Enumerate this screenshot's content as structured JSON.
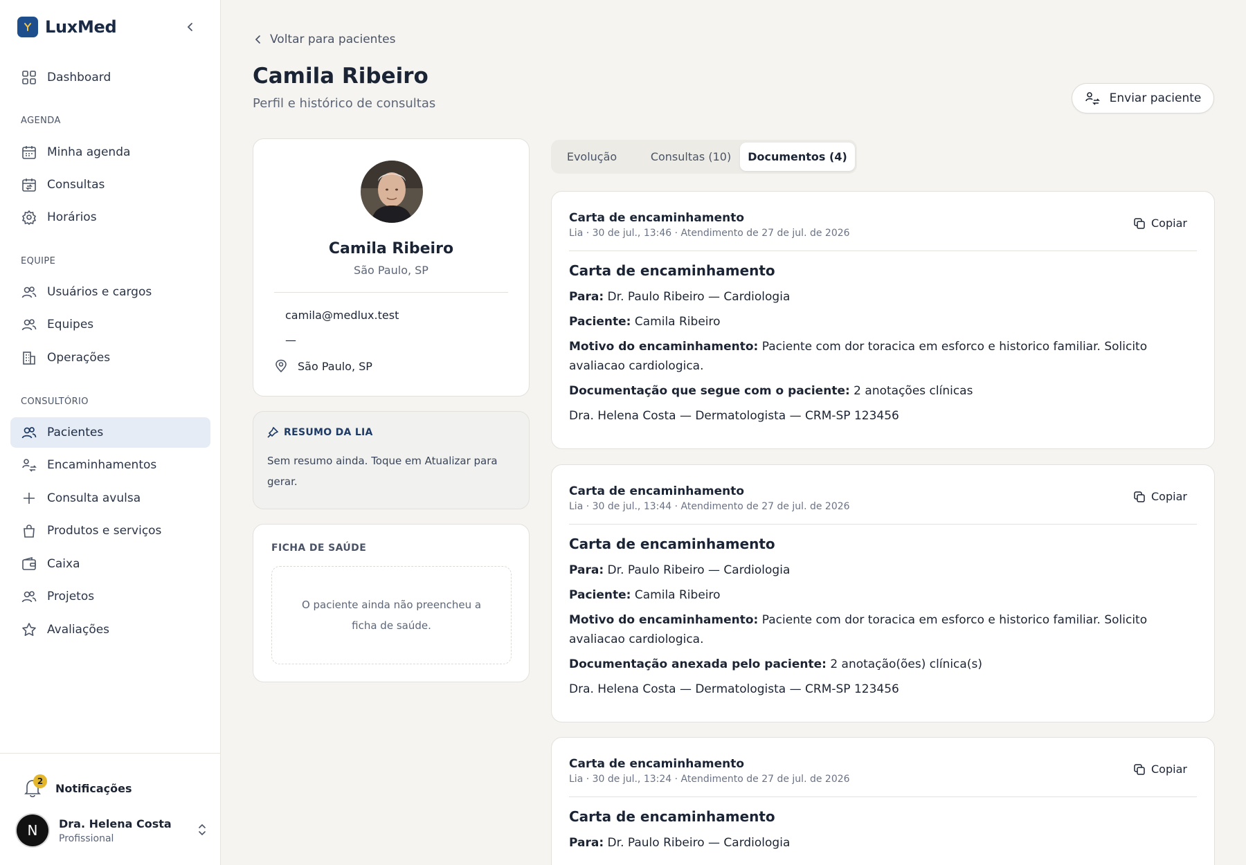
{
  "brand": {
    "name": "LuxMed"
  },
  "sidebar": {
    "dashboard": "Dashboard",
    "sections": {
      "agenda": "AGENDA",
      "equipe": "EQUIPE",
      "consultorio": "CONSULTÓRIO"
    },
    "agenda_items": [
      "Minha agenda",
      "Consultas",
      "Horários"
    ],
    "equipe_items": [
      "Usuários e cargos",
      "Equipes",
      "Operações"
    ],
    "consultorio_items": [
      "Pacientes",
      "Encaminhamentos",
      "Consulta avulsa",
      "Produtos e serviços",
      "Caixa",
      "Projetos",
      "Avaliações"
    ],
    "notifications_label": "Notificações",
    "notifications_count": "2",
    "user": {
      "initial": "N",
      "name": "Dra. Helena Costa",
      "role": "Profissional"
    }
  },
  "header": {
    "back_label": "Voltar para pacientes",
    "title": "Camila Ribeiro",
    "subtitle": "Perfil e histórico de consultas",
    "send_label": "Enviar paciente"
  },
  "profile": {
    "name": "Camila Ribeiro",
    "location": "São Paulo, SP",
    "email": "camila@medlux.test",
    "phone": "—",
    "city": "São Paulo, SP"
  },
  "summary": {
    "title": "RESUMO DA LIA",
    "text": "Sem resumo ainda. Toque em Atualizar para gerar."
  },
  "health": {
    "title": "FICHA DE SAÚDE",
    "empty": "O paciente ainda não preencheu a ficha de saúde."
  },
  "tabs": [
    "Evolução",
    "Consultas (10)",
    "Documentos (4)"
  ],
  "copy_label": "Copiar",
  "documents": [
    {
      "title": "Carta de encaminhamento",
      "meta": "Lia · 30 de jul., 13:46 · Atendimento de 27 de jul. de 2026",
      "heading": "Carta de encaminhamento",
      "para_label": "Para:",
      "para": " Dr. Paulo Ribeiro — Cardiologia",
      "paciente_label": "Paciente:",
      "paciente": " Camila Ribeiro",
      "motivo_label": "Motivo do encaminhamento:",
      "motivo": " Paciente com dor toracica em esforco e historico familiar. Solicito avaliacao cardiologica.",
      "doc_label": "Documentação que segue com o paciente:",
      "doc": " 2 anotações clínicas",
      "signature": "Dra. Helena Costa — Dermatologista — CRM-SP 123456"
    },
    {
      "title": "Carta de encaminhamento",
      "meta": "Lia · 30 de jul., 13:44 · Atendimento de 27 de jul. de 2026",
      "heading": "Carta de encaminhamento",
      "para_label": "Para:",
      "para": " Dr. Paulo Ribeiro — Cardiologia",
      "paciente_label": "Paciente:",
      "paciente": " Camila Ribeiro",
      "motivo_label": "Motivo do encaminhamento:",
      "motivo": " Paciente com dor toracica em esforco e historico familiar. Solicito avaliacao cardiologica.",
      "doc_label": "Documentação anexada pelo paciente:",
      "doc": " 2 anotação(ões) clínica(s)",
      "signature": "Dra. Helena Costa — Dermatologista — CRM-SP 123456"
    },
    {
      "title": "Carta de encaminhamento",
      "meta": "Lia · 30 de jul., 13:24 · Atendimento de 27 de jul. de 2026",
      "heading": "Carta de encaminhamento",
      "para_label": "Para:",
      "para": " Dr. Paulo Ribeiro — Cardiologia"
    }
  ],
  "colors": {
    "accent": "#1e4e8c",
    "active_bg": "#e6ecf5",
    "badge": "#e4b62c",
    "background": "#f5f4f0"
  }
}
